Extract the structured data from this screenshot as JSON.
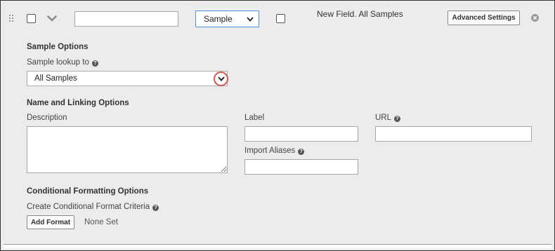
{
  "header": {
    "type_select_value": "Sample",
    "field_title": "New Field. All Samples",
    "advanced_settings_label": "Advanced Settings",
    "name_input_value": ""
  },
  "sample_options": {
    "section_title": "Sample Options",
    "lookup_label": "Sample lookup to",
    "lookup_value": "All Samples"
  },
  "name_linking": {
    "section_title": "Name and Linking Options",
    "description_label": "Description",
    "label_label": "Label",
    "url_label": "URL",
    "import_aliases_label": "Import Aliases"
  },
  "conditional": {
    "section_title": "Conditional Formatting Options",
    "criteria_label": "Create Conditional Format Criteria",
    "add_format_label": "Add Format",
    "none_set_text": "None Set"
  },
  "icons": {
    "drag": "drag-handle-icon",
    "collapse": "chevron-down-icon",
    "close": "close-circle-icon",
    "help": "question-circle-icon"
  },
  "colors": {
    "panel_bg": "#ececec",
    "focus_border": "#4a90d9",
    "highlight_ring": "#d9534f"
  }
}
